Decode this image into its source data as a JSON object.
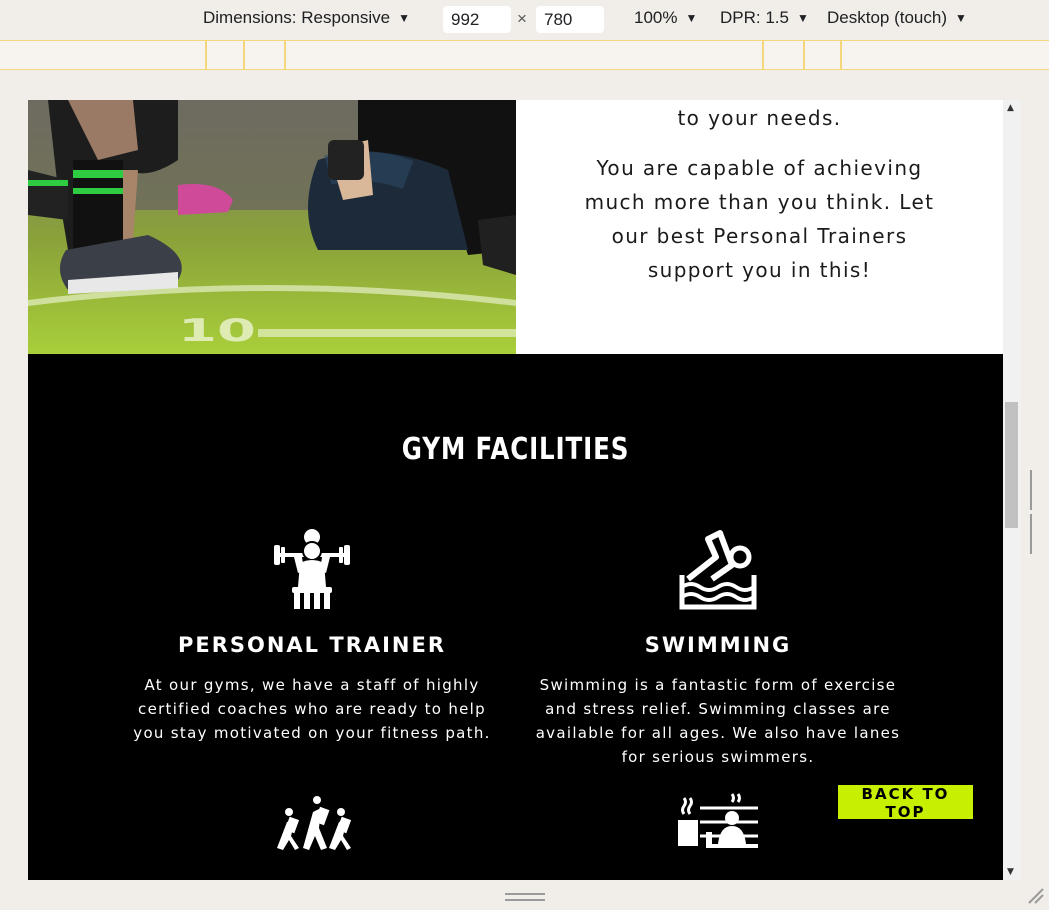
{
  "devtools": {
    "dimensions_label": "Dimensions: Responsive",
    "width_value": "992",
    "height_value": "780",
    "times": "×",
    "zoom": "100%",
    "dpr": "DPR: 1.5",
    "device_mode": "Desktop (touch)"
  },
  "intro": {
    "line_tail": "to your needs.",
    "paragraph": "You are capable of achieving much more than you think. Let our best Personal Trainers support you in this!"
  },
  "facilities": {
    "title": "GYM FACILITIES",
    "items": [
      {
        "icon": "weightlifting-icon",
        "title": "PERSONAL TRAINER",
        "text": "At our gyms, we have a staff of highly certified coaches who are ready to help you stay motivated on your fitness path."
      },
      {
        "icon": "swimming-icon",
        "title": "SWIMMING",
        "text": "Swimming is a fantastic form of exercise and stress relief. Swimming classes are available for all ages. We also have lanes for serious swimmers."
      },
      {
        "icon": "group-exercise-icon"
      },
      {
        "icon": "sauna-icon"
      }
    ]
  },
  "back_to_top": "BACK TO TOP",
  "colors": {
    "accent": "#c7f000",
    "section_bg": "#000000",
    "page_bg": "#ffffff"
  }
}
